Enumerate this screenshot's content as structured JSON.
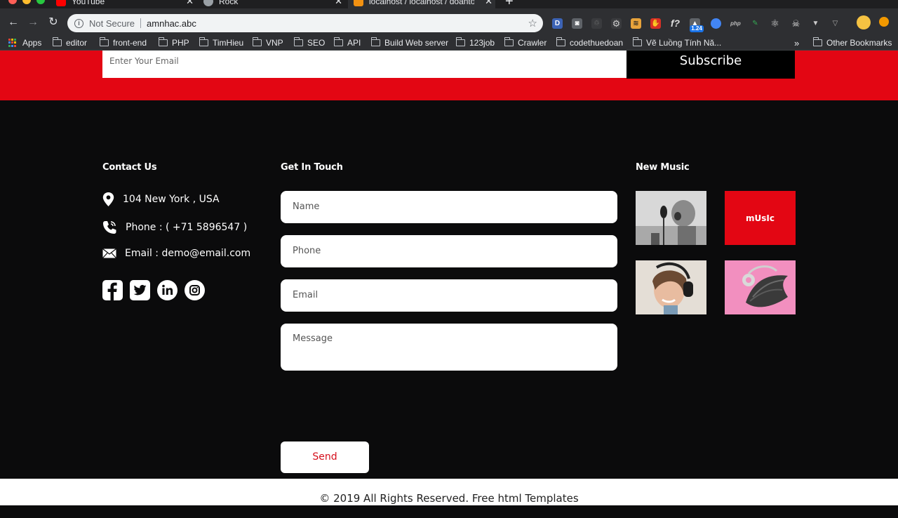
{
  "browser": {
    "tabs": [
      {
        "title": "YouTube"
      },
      {
        "title": "Rock"
      },
      {
        "title": "localhost / localhost / doantot..."
      }
    ],
    "address": {
      "security": "Not Secure",
      "url": "amnhac.abc"
    },
    "bookmarks": [
      "Apps",
      "editor",
      "front-end",
      "PHP",
      "TimHieu",
      "VNP",
      "SEO",
      "API",
      "Build Web server",
      "123job",
      "Crawler",
      "codethuedoan",
      "Vẽ Luồng Tính Nă...",
      "Other Bookmarks"
    ],
    "overflow": "»",
    "extension_badge": "1.24"
  },
  "newsletter": {
    "email_placeholder": "Enter Your Email",
    "subscribe_label": "Subscribe"
  },
  "contact": {
    "title": "Contact Us",
    "address": "104 New York , USA",
    "phone": "Phone : ( +71 5896547 )",
    "email": "Email : demo@email.com"
  },
  "touch": {
    "title": "Get In Touch",
    "name_placeholder": "Name",
    "phone_placeholder": "Phone",
    "email_placeholder": "Email",
    "message_placeholder": "Message",
    "send_label": "Send"
  },
  "music": {
    "title": "New Music",
    "tile_text": "mUsIc"
  },
  "colors": {
    "accent_red": "#e30613",
    "footer_bg": "#0b0b0c",
    "send_text": "#d50f1c"
  },
  "copyright": "© 2019 All Rights Reserved. Free html Templates"
}
